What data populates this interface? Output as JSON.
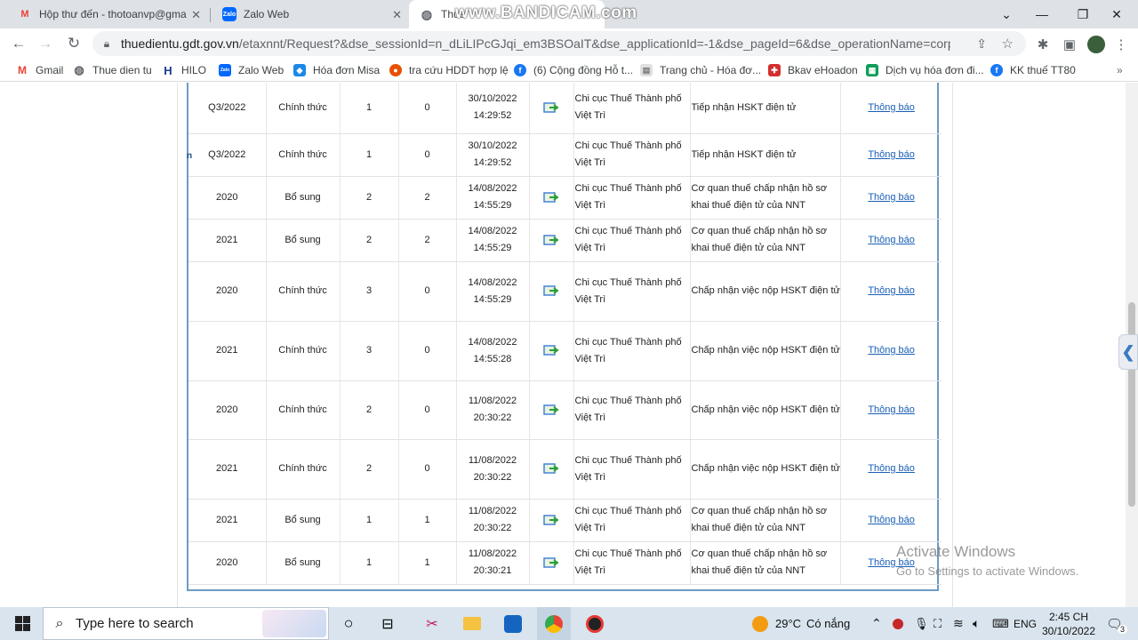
{
  "browser": {
    "tabs": [
      {
        "title": "Hộp thư đến - thotoanvp@gmail",
        "icon": "gmail-icon"
      },
      {
        "title": "Zalo Web",
        "icon": "zalo-icon"
      },
      {
        "title": "Thue",
        "icon": "globe-icon",
        "active": true
      }
    ],
    "url_host": "thuedientu.gdt.gov.vn",
    "url_path": "/etaxnnt/Request?&dse_sessionId=n_dLiLIPcGJqi_em3BSOaIT&dse_applicationId=-1&dse_pageId=6&dse_operationName=corporateHomeP...",
    "watermark": "www.BANDICAM.com",
    "bookmarks": [
      {
        "label": "Gmail",
        "icon": "gmail-icon",
        "color": "#ea4335"
      },
      {
        "label": "Thue dien tu",
        "icon": "globe-icon",
        "color": "#5f6368"
      },
      {
        "label": "HILO",
        "icon": "hilo-icon",
        "color": "#1a3a8f"
      },
      {
        "label": "Zalo Web",
        "icon": "zalo-icon",
        "color": "#0068ff"
      },
      {
        "label": "Hóa đơn Misa",
        "icon": "misa-icon",
        "color": "#1e88e5"
      },
      {
        "label": "tra cứu HDDT hợp lệ",
        "icon": "lookup-icon",
        "color": "#e65100"
      },
      {
        "label": "(6) Cộng đồng Hỗ t...",
        "icon": "facebook-icon",
        "color": "#1877f2"
      },
      {
        "label": "Trang chủ - Hóa đơ...",
        "icon": "doc-icon",
        "color": "#9e9e9e"
      },
      {
        "label": "Bkav eHoadon",
        "icon": "bkav-icon",
        "color": "#d32f2f"
      },
      {
        "label": "Dịch vụ hóa đơn đi...",
        "icon": "sheet-icon",
        "color": "#0f9d58"
      },
      {
        "label": "KK thuế TT80",
        "icon": "facebook-icon",
        "color": "#1877f2"
      }
    ]
  },
  "side_label": "n",
  "table": {
    "rows": [
      {
        "period": "Q3/2022",
        "type": "Chính thức",
        "c1": "1",
        "c2": "0",
        "date": "30/10/2022",
        "time": "14:29:52",
        "has_icon": true,
        "office1": "Chi cục Thuế Thành phố",
        "office2": "Việt Trì",
        "status1": "Tiếp nhận HSKT điện tử",
        "status2": "",
        "link": "Thông báo"
      },
      {
        "period": "Q3/2022",
        "type": "Chính thức",
        "c1": "1",
        "c2": "0",
        "date": "30/10/2022",
        "time": "14:29:52",
        "has_icon": false,
        "office1": "Chi cục Thuế Thành phố",
        "office2": "Việt Trì",
        "status1": "Tiếp nhận HSKT điện tử",
        "status2": "",
        "link": "Thông báo"
      },
      {
        "period": "2020",
        "type": "Bổ sung",
        "c1": "2",
        "c2": "2",
        "date": "14/08/2022",
        "time": "14:55:29",
        "has_icon": true,
        "office1": "Chi cục Thuế Thành phố",
        "office2": "Việt Trì",
        "status1": "Cơ quan thuế chấp nhận hồ sơ",
        "status2": "khai thuế điện tử của NNT",
        "link": "Thông báo"
      },
      {
        "period": "2021",
        "type": "Bổ sung",
        "c1": "2",
        "c2": "2",
        "date": "14/08/2022",
        "time": "14:55:29",
        "has_icon": true,
        "office1": "Chi cục Thuế Thành phố",
        "office2": "Việt Trì",
        "status1": "Cơ quan thuế chấp nhận hồ sơ",
        "status2": "khai thuế điện tử của NNT",
        "link": "Thông báo"
      },
      {
        "period": "2020",
        "type": "Chính thức",
        "c1": "3",
        "c2": "0",
        "date": "14/08/2022",
        "time": "14:55:29",
        "has_icon": true,
        "office1": "Chi cục Thuế Thành phố",
        "office2": "Việt Trì",
        "status1": "Chấp nhận việc nộp HSKT điện tử",
        "status2": "",
        "link": "Thông báo"
      },
      {
        "period": "2021",
        "type": "Chính thức",
        "c1": "3",
        "c2": "0",
        "date": "14/08/2022",
        "time": "14:55:28",
        "has_icon": true,
        "office1": "Chi cục Thuế Thành phố",
        "office2": "Việt Trì",
        "status1": "Chấp nhận việc nộp HSKT điện tử",
        "status2": "",
        "link": "Thông báo"
      },
      {
        "period": "2020",
        "type": "Chính thức",
        "c1": "2",
        "c2": "0",
        "date": "11/08/2022",
        "time": "20:30:22",
        "has_icon": true,
        "office1": "Chi cục Thuế Thành phố",
        "office2": "Việt Trì",
        "status1": "Chấp nhận việc nộp HSKT điện tử",
        "status2": "",
        "link": "Thông báo"
      },
      {
        "period": "2021",
        "type": "Chính thức",
        "c1": "2",
        "c2": "0",
        "date": "11/08/2022",
        "time": "20:30:22",
        "has_icon": true,
        "office1": "Chi cục Thuế Thành phố",
        "office2": "Việt Trì",
        "status1": "Chấp nhận việc nộp HSKT điện tử",
        "status2": "",
        "link": "Thông báo"
      },
      {
        "period": "2021",
        "type": "Bổ sung",
        "c1": "1",
        "c2": "1",
        "date": "11/08/2022",
        "time": "20:30:22",
        "has_icon": true,
        "office1": "Chi cục Thuế Thành phố",
        "office2": "Việt Trì",
        "status1": "Cơ quan thuế chấp nhận hồ sơ",
        "status2": "khai thuế điện tử của NNT",
        "link": "Thông báo"
      },
      {
        "period": "2020",
        "type": "Bổ sung",
        "c1": "1",
        "c2": "1",
        "date": "11/08/2022",
        "time": "20:30:21",
        "has_icon": true,
        "office1": "Chi cục Thuế Thành phố",
        "office2": "Việt Trì",
        "status1": "Cơ quan thuế chấp nhận hồ sơ",
        "status2": "khai thuế điện tử của NNT",
        "link": "Thông báo"
      }
    ]
  },
  "activate_windows": {
    "title": "Activate Windows",
    "subtitle": "Go to Settings to activate Windows."
  },
  "taskbar": {
    "search_placeholder": "Type here to search",
    "weather_temp": "29°C",
    "weather_text": "Có nắng",
    "language": "ENG",
    "time": "2:45 CH",
    "date": "30/10/2022",
    "notification_count": "3"
  }
}
